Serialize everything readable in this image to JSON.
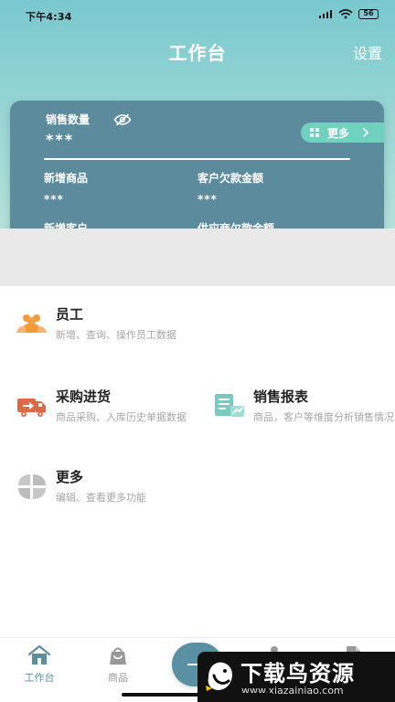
{
  "status_bar": {
    "time": "下午4:34",
    "battery": "56"
  },
  "header": {
    "title": "工作台",
    "settings_label": "设置"
  },
  "summary_card": {
    "sales_label": "销售数量",
    "sales_value": "***",
    "more_label": "更多",
    "metrics": [
      {
        "label": "新增商品",
        "value": "***"
      },
      {
        "label": "客户欠款金额",
        "value": "***"
      },
      {
        "label": "新增客户",
        "value": "***"
      },
      {
        "label": "供应商欠款金额",
        "value": "***"
      }
    ]
  },
  "menu": {
    "items": [
      {
        "title": "员工",
        "description": "新增、查询、操作员工数据",
        "icon": "staff-icon"
      },
      {
        "title": "采购进货",
        "description": "商品采购、入库历史单据数据",
        "icon": "truck-icon"
      },
      {
        "title": "销售报表",
        "description": "商品，客户等维度分析销售情况",
        "icon": "report-icon"
      },
      {
        "title": "更多",
        "description": "编辑、查看更多功能",
        "icon": "more-grid-icon"
      }
    ]
  },
  "bottom_nav": {
    "items": [
      {
        "label": "工作台",
        "icon": "home-icon"
      },
      {
        "label": "商品",
        "icon": "bag-icon"
      }
    ]
  },
  "watermark": {
    "title": "下载鸟资源",
    "url": "www.xiazainiao.com"
  },
  "colors": {
    "header_gradient_top": "#79c8cf",
    "card_background": "#5c8b9d",
    "accent_green": "#6ed2bf",
    "nav_active": "#5b8fa0"
  }
}
